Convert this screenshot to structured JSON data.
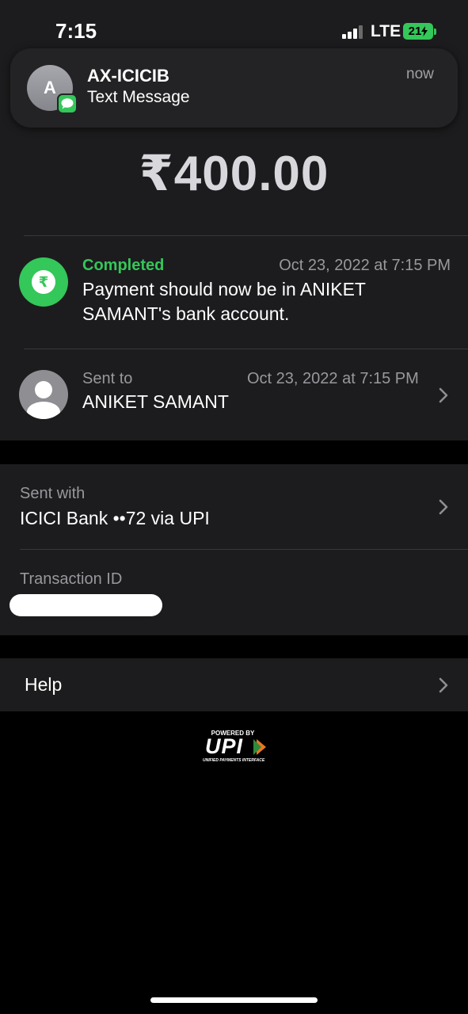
{
  "status_bar": {
    "time": "7:15",
    "network": "LTE",
    "battery": "21"
  },
  "notification": {
    "avatar_letter": "A",
    "sender": "AX-ICICIB",
    "subtitle": "Text Message",
    "time": "now"
  },
  "amount": "₹400.00",
  "status": {
    "label": "Completed",
    "date": "Oct 23, 2022 at 7:15 PM",
    "description": "Payment should now be in ANIKET SAMANT's bank account.",
    "icon": "rupee-icon"
  },
  "recipient": {
    "label": "Sent to",
    "date": "Oct 23, 2022 at 7:15 PM",
    "name": "ANIKET SAMANT",
    "icon": "person-icon"
  },
  "sent_with": {
    "label": "Sent with",
    "value": "ICICI Bank ••72 via UPI"
  },
  "transaction": {
    "label": "Transaction ID"
  },
  "help": {
    "label": "Help"
  },
  "footer": {
    "powered_by": "POWERED BY",
    "brand": "UPI",
    "tagline": "UNIFIED PAYMENTS INTERFACE"
  },
  "colors": {
    "accent_green": "#34c759",
    "surface": "#1c1c1e",
    "background": "#000000",
    "secondary_text": "#98989d"
  }
}
